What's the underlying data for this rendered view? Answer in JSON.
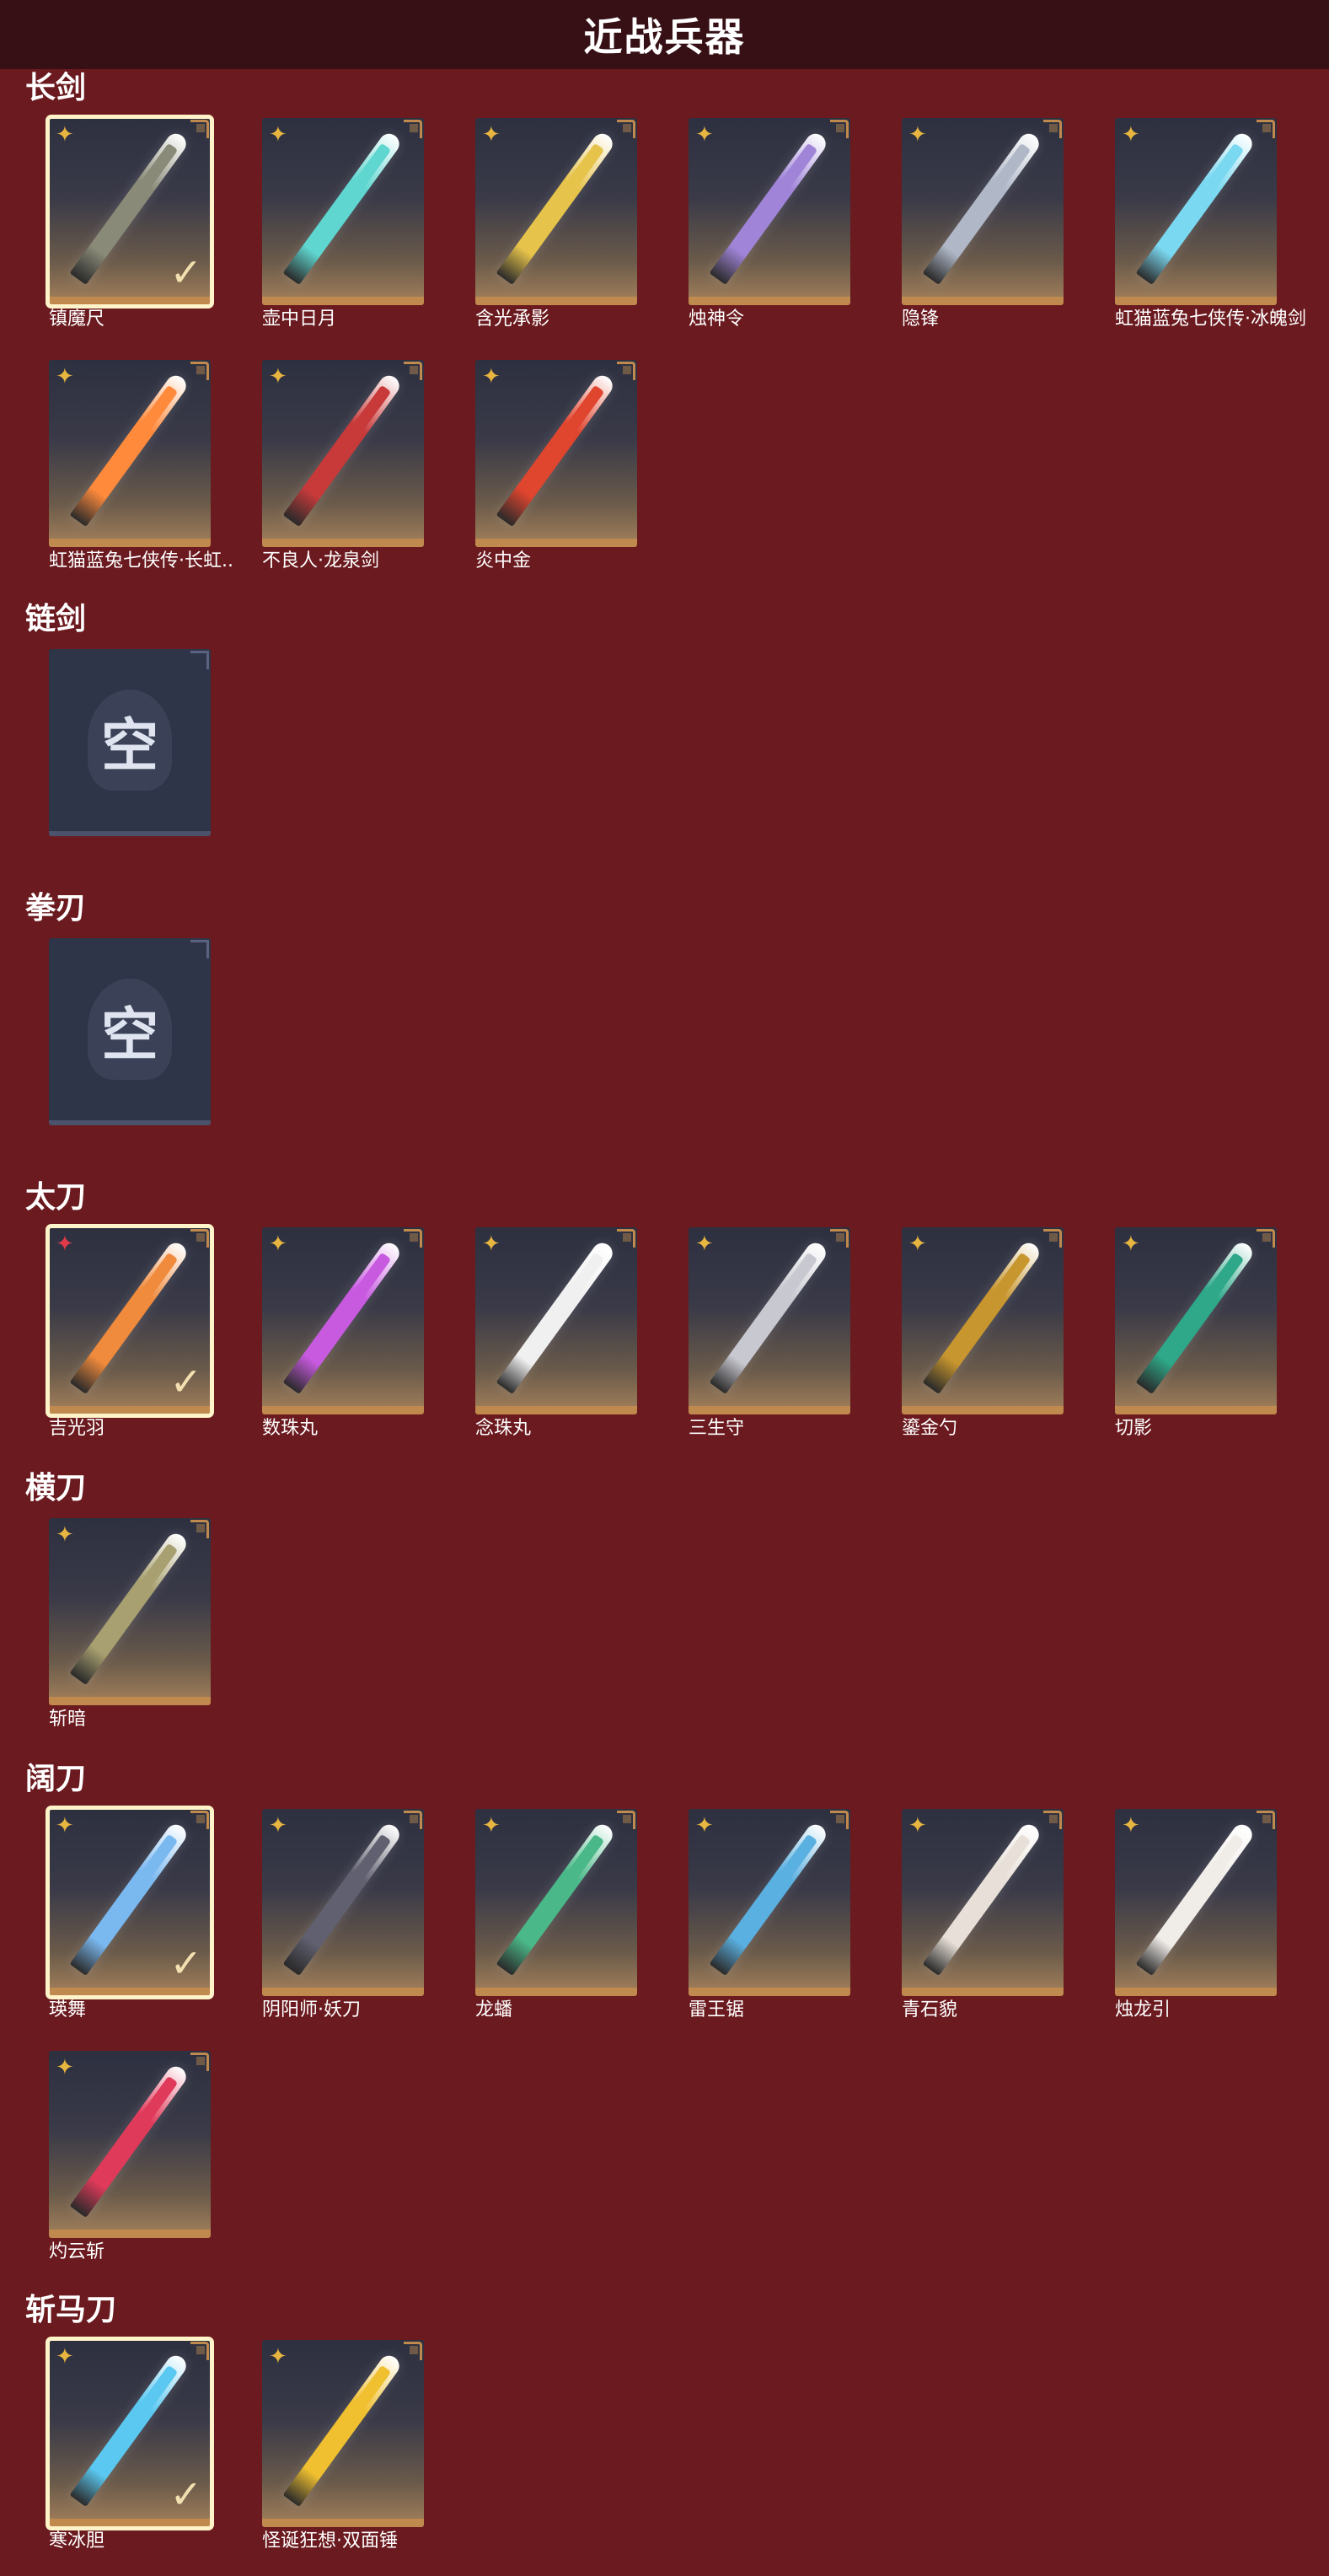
{
  "header": {
    "title": "近战兵器"
  },
  "sections": {
    "changjian": {
      "title": "长剑",
      "items": [
        {
          "name": "镇魔尺",
          "selected": true,
          "color": "#8a8a78"
        },
        {
          "name": "壶中日月",
          "color": "#5fd6d0"
        },
        {
          "name": "含光承影",
          "color": "#e6c34a"
        },
        {
          "name": "烛神令",
          "color": "#a084d8"
        },
        {
          "name": "隐锋",
          "color": "#b0b8c8"
        },
        {
          "name": "虹猫蓝兔七侠传·冰魄剑",
          "color": "#7ad8f0"
        },
        {
          "name": "虹猫蓝兔七侠传·长虹剑",
          "display": "虹猫蓝兔七侠传·长虹..",
          "color": "#ff8a3c"
        },
        {
          "name": "不良人·龙泉剑",
          "color": "#c83a3a"
        },
        {
          "name": "炎中金",
          "color": "#e0452e"
        }
      ]
    },
    "lianjian": {
      "title": "链剑",
      "empty_text": "空"
    },
    "quanren": {
      "title": "拳刃",
      "empty_text": "空"
    },
    "taidao": {
      "title": "太刀",
      "items": [
        {
          "name": "吉光羽",
          "selected": true,
          "red_star": true,
          "color": "#f08a3c"
        },
        {
          "name": "数珠丸",
          "color": "#c85ae0"
        },
        {
          "name": "念珠丸",
          "color": "#f0f0f0"
        },
        {
          "name": "三生守",
          "color": "#c8c8d0"
        },
        {
          "name": "鎏金勺",
          "color": "#c8962e"
        },
        {
          "name": "切影",
          "color": "#2ea888"
        }
      ]
    },
    "hengdao": {
      "title": "横刀",
      "items": [
        {
          "name": "斩暗",
          "color": "#a8a070"
        }
      ]
    },
    "kuodao": {
      "title": "阔刀",
      "items": [
        {
          "name": "瑛舞",
          "selected": true,
          "color": "#7ab8f0"
        },
        {
          "name": "阴阳师·妖刀",
          "color": "#606070"
        },
        {
          "name": "龙蟠",
          "color": "#4ab888"
        },
        {
          "name": "雷王锯",
          "color": "#5ab0e0"
        },
        {
          "name": "青石貌",
          "color": "#e8e0d8"
        },
        {
          "name": "烛龙引",
          "color": "#f0ece8"
        },
        {
          "name": "灼云斩",
          "color": "#e03a5a"
        }
      ]
    },
    "zhanmadao": {
      "title": "斩马刀",
      "items": [
        {
          "name": "寒冰胆",
          "selected": true,
          "color": "#5ac8f0"
        },
        {
          "name": "怪诞狂想·双面锤",
          "color": "#f0c030"
        }
      ]
    }
  },
  "icons": {
    "rarity": "sparkle-icon",
    "check": "checkmark-icon"
  },
  "glyphs": {
    "star": "✦",
    "check": "✓"
  }
}
